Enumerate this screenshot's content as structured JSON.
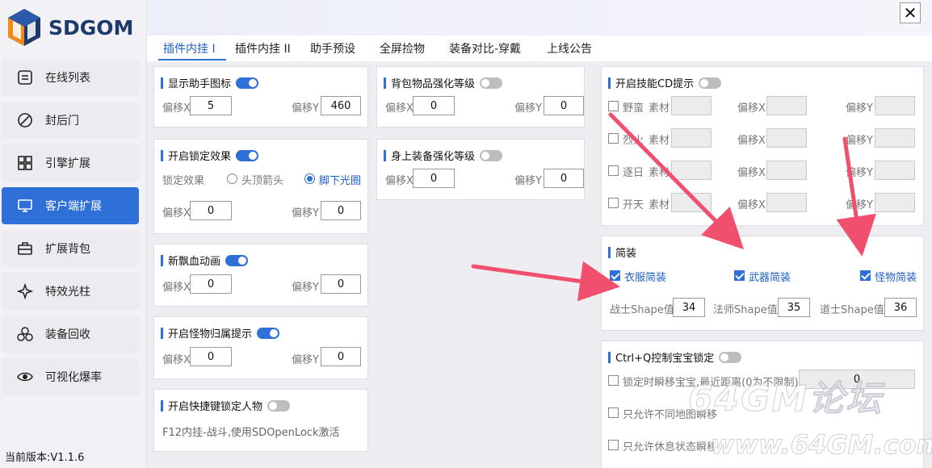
{
  "app": {
    "logo_text": "SDGOM",
    "version_label": "当前版本:V1.1.6",
    "close_symbol": "✕",
    "accent_color": "#2f6fd8"
  },
  "sidebar": {
    "items": [
      {
        "label": "在线列表",
        "icon": "list-icon"
      },
      {
        "label": "封后门",
        "icon": "block-icon"
      },
      {
        "label": "引擎扩展",
        "icon": "grid-icon"
      },
      {
        "label": "客户端扩展",
        "icon": "monitor-icon",
        "active": true
      },
      {
        "label": "扩展背包",
        "icon": "bag-icon"
      },
      {
        "label": "特效光柱",
        "icon": "sparkle-icon"
      },
      {
        "label": "装备回收",
        "icon": "recycle-icon"
      },
      {
        "label": "可视化爆率",
        "icon": "eye-icon"
      }
    ]
  },
  "tabs": [
    {
      "label": "插件内挂 I",
      "active": true
    },
    {
      "label": "插件内挂 II"
    },
    {
      "label": "助手预设"
    },
    {
      "label": "全屏捡物"
    },
    {
      "label": "装备对比-穿戴"
    },
    {
      "label": "上线公告"
    }
  ],
  "left_col": {
    "helper_icon": {
      "title": "显示助手图标",
      "enabled": true,
      "x_label": "偏移X",
      "x_value": "5",
      "y_label": "偏移Y",
      "y_value": "460"
    },
    "lock_effect": {
      "title": "开启锁定效果",
      "enabled": true,
      "effect_label": "锁定效果",
      "option_head": "头顶箭头",
      "option_foot": "脚下光圈",
      "selected": "脚下光圈",
      "x_label": "偏移X",
      "x_value": "0",
      "y_label": "偏移Y",
      "y_value": "0"
    },
    "blood_anim": {
      "title": "新飘血动画",
      "enabled": true,
      "x_label": "偏移X",
      "x_value": "0",
      "y_label": "偏移Y",
      "y_value": "0"
    },
    "monster_owner": {
      "title": "开启怪物归属提示",
      "enabled": true,
      "x_label": "偏移X",
      "x_value": "0",
      "y_label": "偏移Y",
      "y_value": "0"
    },
    "hotkey_lock": {
      "title": "开启快捷键锁定人物",
      "enabled": false,
      "note": "F12内挂-战斗,使用SDOpenLock激活"
    }
  },
  "mid_col": {
    "bag_level": {
      "title": "背包物品强化等级",
      "enabled": false,
      "x_label": "偏移X",
      "x_value": "0",
      "y_label": "偏移Y",
      "y_value": "0"
    },
    "equip_level": {
      "title": "身上装备强化等级",
      "enabled": false,
      "x_label": "偏移X",
      "x_value": "0",
      "y_label": "偏移Y",
      "y_value": "0"
    }
  },
  "right_col": {
    "skill_cd": {
      "title": "开启技能CD提示",
      "enabled": false,
      "material_label": "素材",
      "x_label": "偏移X",
      "y_label": "偏移Y",
      "skills": [
        "野蛮",
        "烈火",
        "逐日",
        "开天"
      ]
    },
    "simple": {
      "title": "简装",
      "cloth": "衣服简装",
      "weapon": "武器简装",
      "monster": "怪物简装",
      "warrior_label": "战士Shape值",
      "warrior_value": "34",
      "mage_label": "法师Shape值",
      "mage_value": "35",
      "taoist_label": "道士Shape值",
      "taoist_value": "36"
    },
    "pet_lock": {
      "title": "Ctrl+Q控制宝宝锁定",
      "enabled": false,
      "opt1": "锁定时瞬移宝宝,最近距离(0为不限制)",
      "opt1_value": "0",
      "opt2": "只允许不同地图瞬移",
      "opt3": "只允许休息状态瞬移"
    }
  },
  "watermark": {
    "line1": "64GM论坛",
    "line2": "www.64GM.com"
  }
}
